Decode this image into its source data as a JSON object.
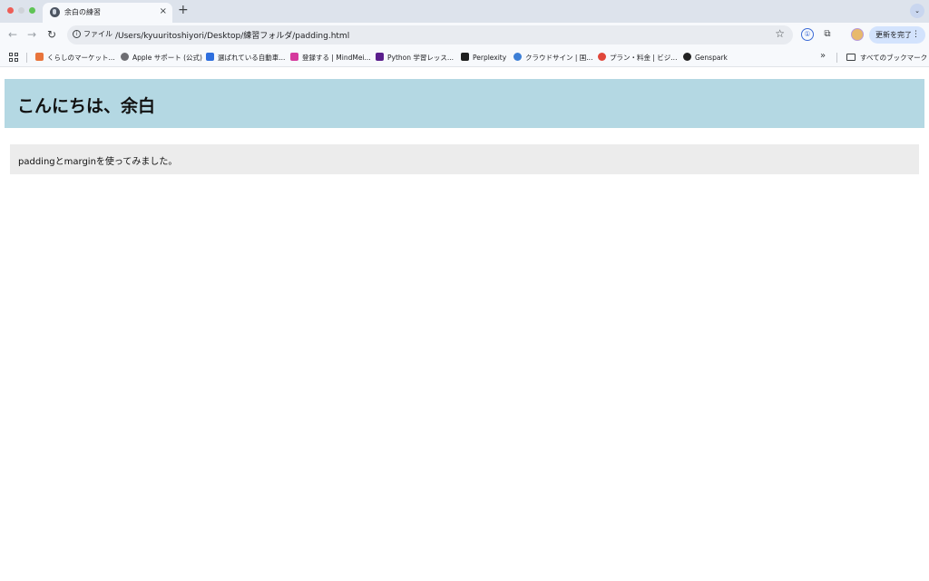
{
  "browser": {
    "tab": {
      "title": "余白の練習",
      "close_glyph": "×"
    },
    "new_tab_glyph": "+",
    "tab_search_glyph": "⌄",
    "nav": {
      "back": "←",
      "forward": "→",
      "reload": "↻"
    },
    "omnibox": {
      "info_glyph": "i",
      "scheme_label": "ファイル",
      "url": "/Users/kyuuritoshiyori/Desktop/練習フォルダ/padding.html",
      "star_glyph": "☆"
    },
    "toolbar_icons": {
      "password_glyph": "①",
      "extensions_glyph": "⧉"
    },
    "update_button": {
      "label": "更新を完了",
      "menu_glyph": "⋮"
    }
  },
  "bookmarks_bar": {
    "items": [
      {
        "label": "くらしのマーケット...",
        "icon": "kurashi-icon",
        "color": "#e8743b"
      },
      {
        "label": "Apple サポート (公式)",
        "icon": "apple-icon",
        "color": "#6e6e73"
      },
      {
        "label": "選ばれている自動車...",
        "icon": "b-logo-icon",
        "color": "#2f6fde"
      },
      {
        "label": "登録する | MindMei...",
        "icon": "mindmeister-icon",
        "color": "#d53a9d"
      },
      {
        "label": "Python 学習レッス...",
        "icon": "python-course-icon",
        "color": "#5a1e8c"
      },
      {
        "label": "Perplexity",
        "icon": "perplexity-icon",
        "color": "#1f1f1f"
      },
      {
        "label": "クラウドサイン | 国...",
        "icon": "cloudsign-icon",
        "color": "#3d7fd6"
      },
      {
        "label": "プラン・料金 | ビジ...",
        "icon": "plan-icon",
        "color": "#e0463a"
      },
      {
        "label": "Genspark",
        "icon": "genspark-icon",
        "color": "#222222"
      }
    ],
    "more_glyph": "»",
    "all_bookmarks_label": "すべてのブックマーク"
  },
  "page": {
    "heading": "こんにちは、余白",
    "paragraph": "paddingとmarginを使ってみました。",
    "header_bg": "#b4d8e3",
    "box_bg": "#ececec"
  }
}
